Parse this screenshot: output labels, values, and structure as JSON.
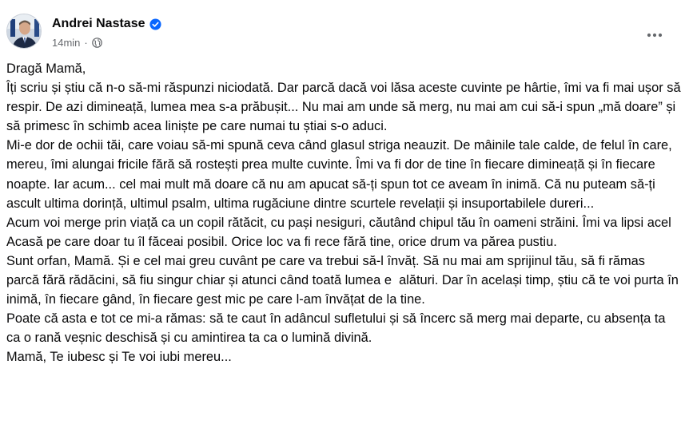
{
  "post": {
    "author": {
      "name": "Andrei Nastase",
      "verified": true,
      "avatar_icon": "profile-photo"
    },
    "meta": {
      "timestamp": "14min",
      "separator": "·",
      "audience_icon": "globe-icon"
    },
    "more_icon": "ellipsis-icon",
    "paragraphs": [
      "Dragă Mamă,",
      "Îți scriu și știu că n-o să-mi răspunzi niciodată. Dar parcă dacă voi lăsa aceste cuvinte pe hârtie, îmi va fi mai ușor să respir. De azi dimineață, lumea mea s-a prăbușit... Nu mai am unde să merg, nu mai am cui să-i spun „mă doare” și să primesc în schimb acea liniște pe care numai tu știai s-o aduci.",
      "Mi-e dor de ochii tăi, care voiau să-mi spună ceva când glasul striga neauzit. De mâinile tale calde, de felul în care, mereu, îmi alungai fricile fără să rostești prea multe cuvinte. Îmi va fi dor de tine în fiecare dimineață și în fiecare noapte. Iar acum... cel mai mult mă doare că nu am apucat să-ți spun tot ce aveam în inimă. Că nu puteam să-ți ascult ultima dorință, ultimul psalm, ultima rugăciune dintre scurtele revelații și insuportabilele dureri...",
      "Acum voi merge prin viață ca un copil rătăcit, cu pași nesiguri, căutând chipul tău în oameni străini. Îmi va lipsi acel Acasă pe care doar tu îl făceai posibil. Orice loc va fi rece fără tine, orice drum va părea pustiu.",
      "Sunt orfan, Mamă. Și e cel mai greu cuvânt pe care va trebui să-l învăț. Să nu mai am sprijinul tău, să fi rămas parcă fără rădăcini, să fiu singur chiar și atunci când toată lumea e  alături. Dar în același timp, știu că te voi purta în inimă, în fiecare gând, în fiecare gest mic pe care l-am învățat de la tine.",
      "Poate că asta e tot ce mi-a rămas: să te caut în adâncul sufletului și să încerc să merg mai departe, cu absența ta ca o rană veșnic deschisă și cu amintirea ta ca o lumină divină.",
      "Mamă, Te iubesc și Te voi iubi mereu..."
    ]
  },
  "colors": {
    "text": "#080809",
    "secondary_text": "#65686c",
    "verified_badge": "#0866ff",
    "background": "#ffffff"
  }
}
